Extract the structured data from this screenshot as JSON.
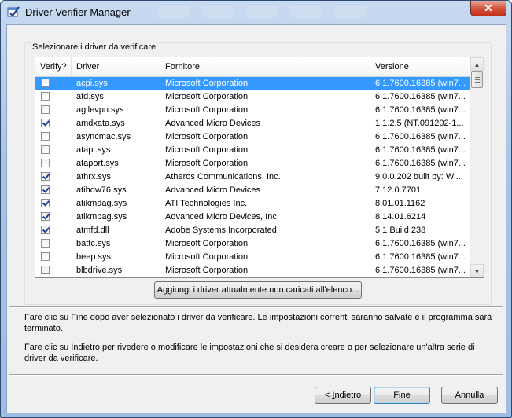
{
  "window": {
    "title": "Driver Verifier Manager",
    "close_glyph": "✕"
  },
  "group": {
    "label": "Selezionare i driver da verificare"
  },
  "list": {
    "columns": [
      "Verify?",
      "Driver",
      "Fornitore",
      "Versione"
    ],
    "rows": [
      {
        "checked": false,
        "driver": "acpi.sys",
        "vendor": "Microsoft Corporation",
        "version": "6.1.7600.16385 (win7...",
        "selected": true
      },
      {
        "checked": false,
        "driver": "afd.sys",
        "vendor": "Microsoft Corporation",
        "version": "6.1.7600.16385 (win7..."
      },
      {
        "checked": false,
        "driver": "agilevpn.sys",
        "vendor": "Microsoft Corporation",
        "version": "6.1.7600.16385 (win7..."
      },
      {
        "checked": true,
        "driver": "amdxata.sys",
        "vendor": "Advanced Micro Devices",
        "version": "1.1.2.5 (NT.091202-1..."
      },
      {
        "checked": false,
        "driver": "asyncmac.sys",
        "vendor": "Microsoft Corporation",
        "version": "6.1.7600.16385 (win7..."
      },
      {
        "checked": false,
        "driver": "atapi.sys",
        "vendor": "Microsoft Corporation",
        "version": "6.1.7600.16385 (win7..."
      },
      {
        "checked": false,
        "driver": "ataport.sys",
        "vendor": "Microsoft Corporation",
        "version": "6.1.7600.16385 (win7..."
      },
      {
        "checked": true,
        "driver": "athrx.sys",
        "vendor": "Atheros Communications, Inc.",
        "version": "9.0.0.202 built by: Wi..."
      },
      {
        "checked": true,
        "driver": "atihdw76.sys",
        "vendor": "Advanced Micro Devices",
        "version": "7.12.0.7701"
      },
      {
        "checked": true,
        "driver": "atikmdag.sys",
        "vendor": "ATI Technologies Inc.",
        "version": "8.01.01.1162"
      },
      {
        "checked": true,
        "driver": "atikmpag.sys",
        "vendor": "Advanced Micro Devices, Inc.",
        "version": "8.14.01.6214"
      },
      {
        "checked": true,
        "driver": "atmfd.dll",
        "vendor": "Adobe Systems Incorporated",
        "version": "5.1 Build 238"
      },
      {
        "checked": false,
        "driver": "battc.sys",
        "vendor": "Microsoft Corporation",
        "version": "6.1.7600.16385 (win7..."
      },
      {
        "checked": false,
        "driver": "beep.sys",
        "vendor": "Microsoft Corporation",
        "version": "6.1.7600.16385 (win7..."
      },
      {
        "checked": false,
        "driver": "blbdrive.sys",
        "vendor": "Microsoft Corporation",
        "version": "6.1.7600.16385 (win7..."
      }
    ]
  },
  "scrollbar": {
    "up_glyph": "▲",
    "down_glyph": "▼"
  },
  "add_button": {
    "prefix": "A",
    "accel": "g",
    "rest": "giungi i driver attualmente non caricati all'elenco..."
  },
  "info": {
    "text1": "Fare clic su Fine dopo aver selezionato i driver da verificare. Le impostazioni correnti saranno salvate e il programma sarà terminato.",
    "text2": "Fare clic su Indietro per rivedere o modificare le impostazioni che si desidera creare o per selezionare un'altra serie di driver da verificare."
  },
  "buttons": {
    "back_prefix": "< ",
    "back_accel": "I",
    "back_rest": "ndietro",
    "finish": "Fine",
    "cancel": "Annulla"
  },
  "colors": {
    "selection": "#3399ff",
    "close": "#c3301b"
  }
}
